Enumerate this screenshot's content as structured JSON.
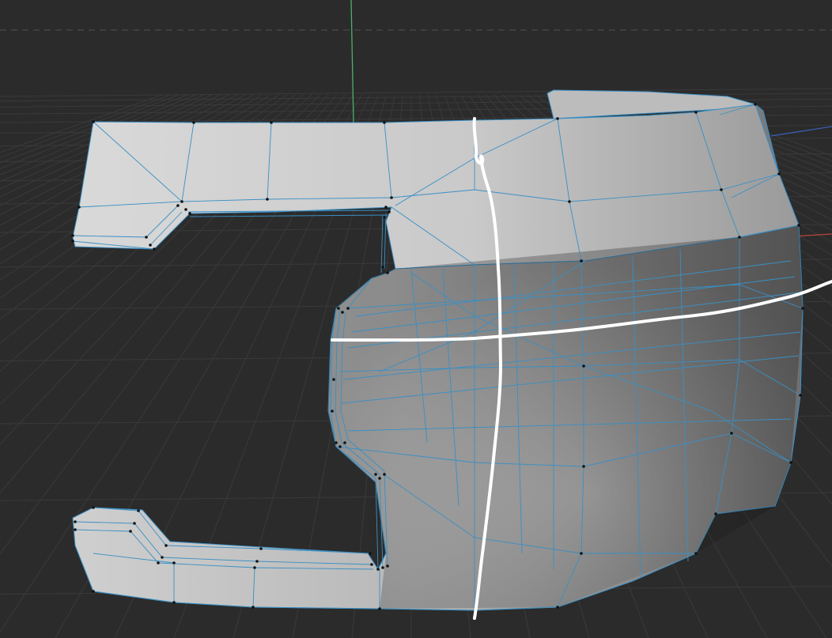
{
  "app": {
    "view": "3D viewport"
  },
  "colors": {
    "background": "#2b2b2b",
    "grid_line": "#3a3a3a",
    "axis_y_green": "#4caf6a",
    "axis_x_red": "#b8443a",
    "axis_z_blue": "#3b5fb5",
    "mesh_edge": "#3a8fc4",
    "vertex": "#111111",
    "annotation_stroke": "#ffffff"
  },
  "icons": {
    "axis_x": "x-axis-line",
    "axis_y": "y-axis-line",
    "axis_z": "z-axis-line"
  }
}
